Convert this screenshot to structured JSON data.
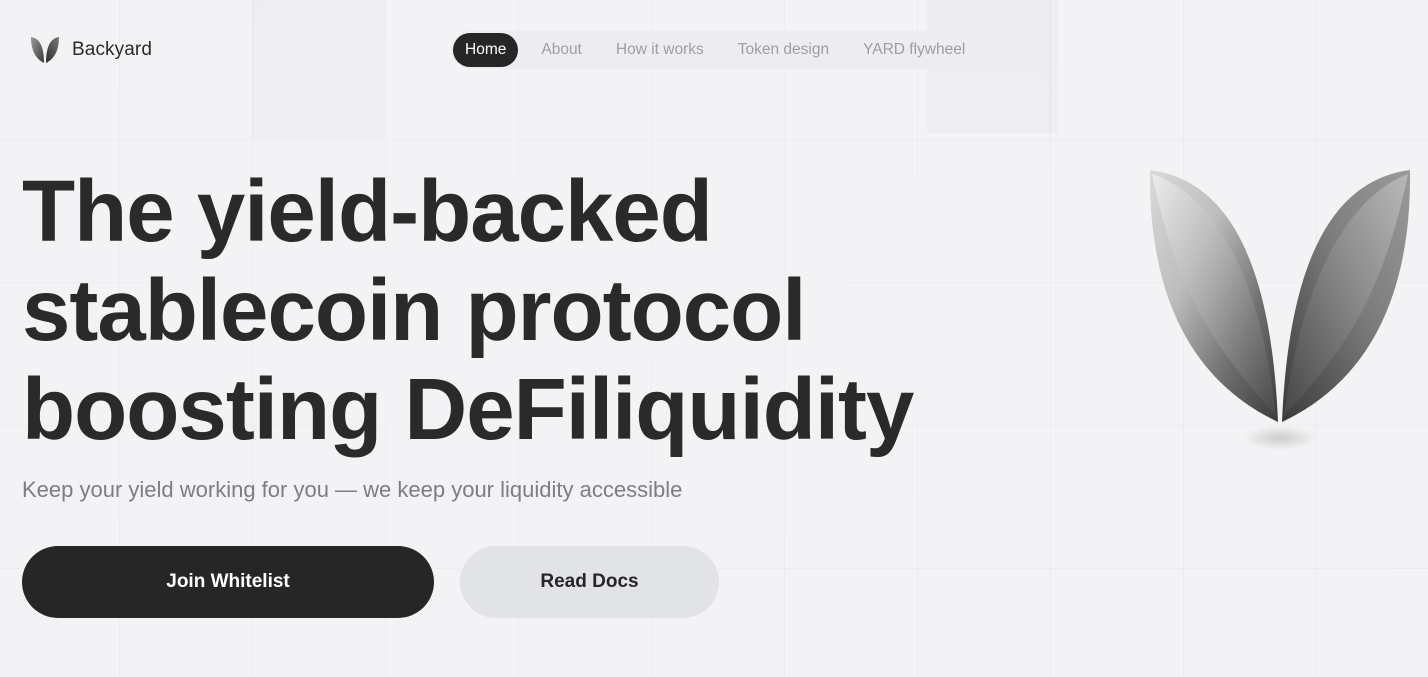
{
  "brand": {
    "name": "Backyard",
    "logo_icon": "leaf-logo-icon"
  },
  "nav": {
    "items": [
      {
        "label": "Home",
        "active": true
      },
      {
        "label": "About",
        "active": false
      },
      {
        "label": "How it works",
        "active": false
      },
      {
        "label": "Token design",
        "active": false
      },
      {
        "label": "YARD flywheel",
        "active": false
      }
    ]
  },
  "hero": {
    "headline_lines": [
      "The yield-backed",
      "stablecoin protocol",
      "boosting DeFiliquidity"
    ],
    "subtitle": "Keep your yield working for you — we keep your liquidity accessible",
    "primary_button": "Join Whitelist",
    "secondary_button": "Read Docs",
    "illustration_icon": "metallic-leaf-icon"
  },
  "colors": {
    "background": "#f3f3f5",
    "text_dark": "#2a2a2a",
    "button_dark": "#262626",
    "button_light": "#e2e3e7",
    "muted_text": "#7d7d82"
  }
}
